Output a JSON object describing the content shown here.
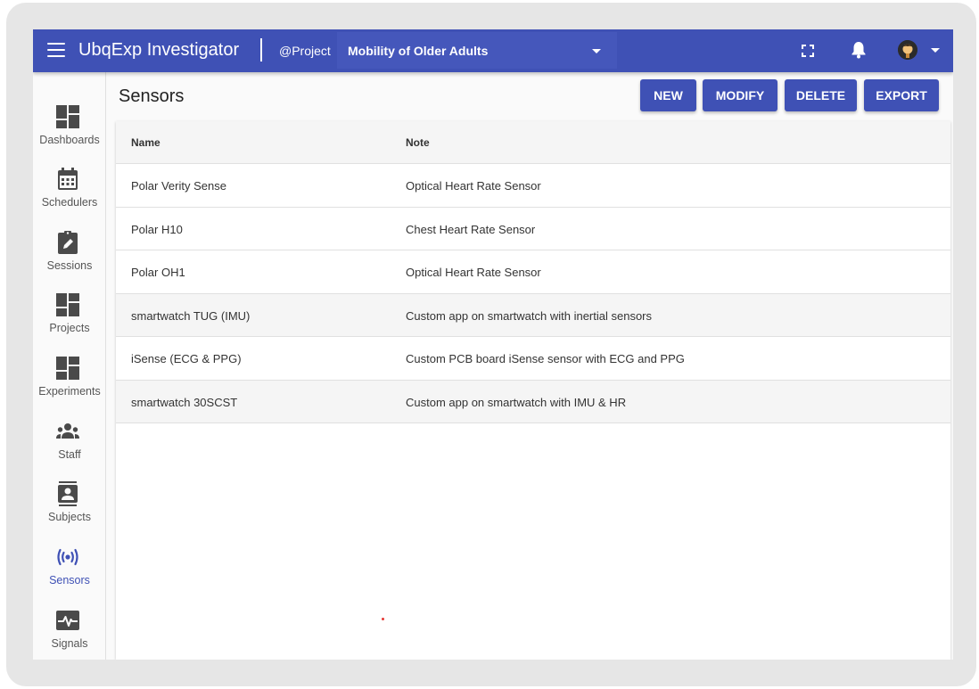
{
  "header": {
    "title": "UbqExp Investigator",
    "project_label": "@Project",
    "project_value": "Mobility of Older Adults",
    "icons": [
      "menu-icon",
      "fullscreen-icon",
      "bell-icon",
      "avatar"
    ]
  },
  "sidebar": {
    "items": [
      {
        "label": "Dashboards",
        "icon": "dashboard-icon",
        "active": false
      },
      {
        "label": "Schedulers",
        "icon": "calendar-icon",
        "active": false
      },
      {
        "label": "Sessions",
        "icon": "clipboard-edit-icon",
        "active": false
      },
      {
        "label": "Projects",
        "icon": "dashboard-icon",
        "active": false
      },
      {
        "label": "Experiments",
        "icon": "dashboard-icon",
        "active": false
      },
      {
        "label": "Staff",
        "icon": "group-icon",
        "active": false
      },
      {
        "label": "Subjects",
        "icon": "contact-icon",
        "active": false
      },
      {
        "label": "Sensors",
        "icon": "sensors-icon",
        "active": true
      },
      {
        "label": "Signals",
        "icon": "signal-icon",
        "active": false
      }
    ]
  },
  "main": {
    "page_title": "Sensors",
    "buttons": {
      "new": "NEW",
      "modify": "MODIFY",
      "delete": "DELETE",
      "export": "EXPORT"
    },
    "table": {
      "columns": [
        "Name",
        "Note"
      ],
      "rows": [
        [
          "Polar Verity Sense",
          "Optical Heart Rate Sensor"
        ],
        [
          "Polar H10",
          "Chest Heart Rate Sensor"
        ],
        [
          "Polar OH1",
          "Optical Heart Rate Sensor"
        ],
        [
          "smartwatch TUG (IMU)",
          "Custom app on smartwatch with inertial sensors"
        ],
        [
          "iSense (ECG & PPG)",
          "Custom PCB board iSense sensor with ECG and PPG"
        ],
        [
          "smartwatch 30SCST",
          "Custom app on smartwatch with IMU & HR"
        ]
      ]
    }
  },
  "colors": {
    "primary": "#3f51b5",
    "active_nav": "#3f51b5",
    "icon": "#4a4a4a"
  }
}
